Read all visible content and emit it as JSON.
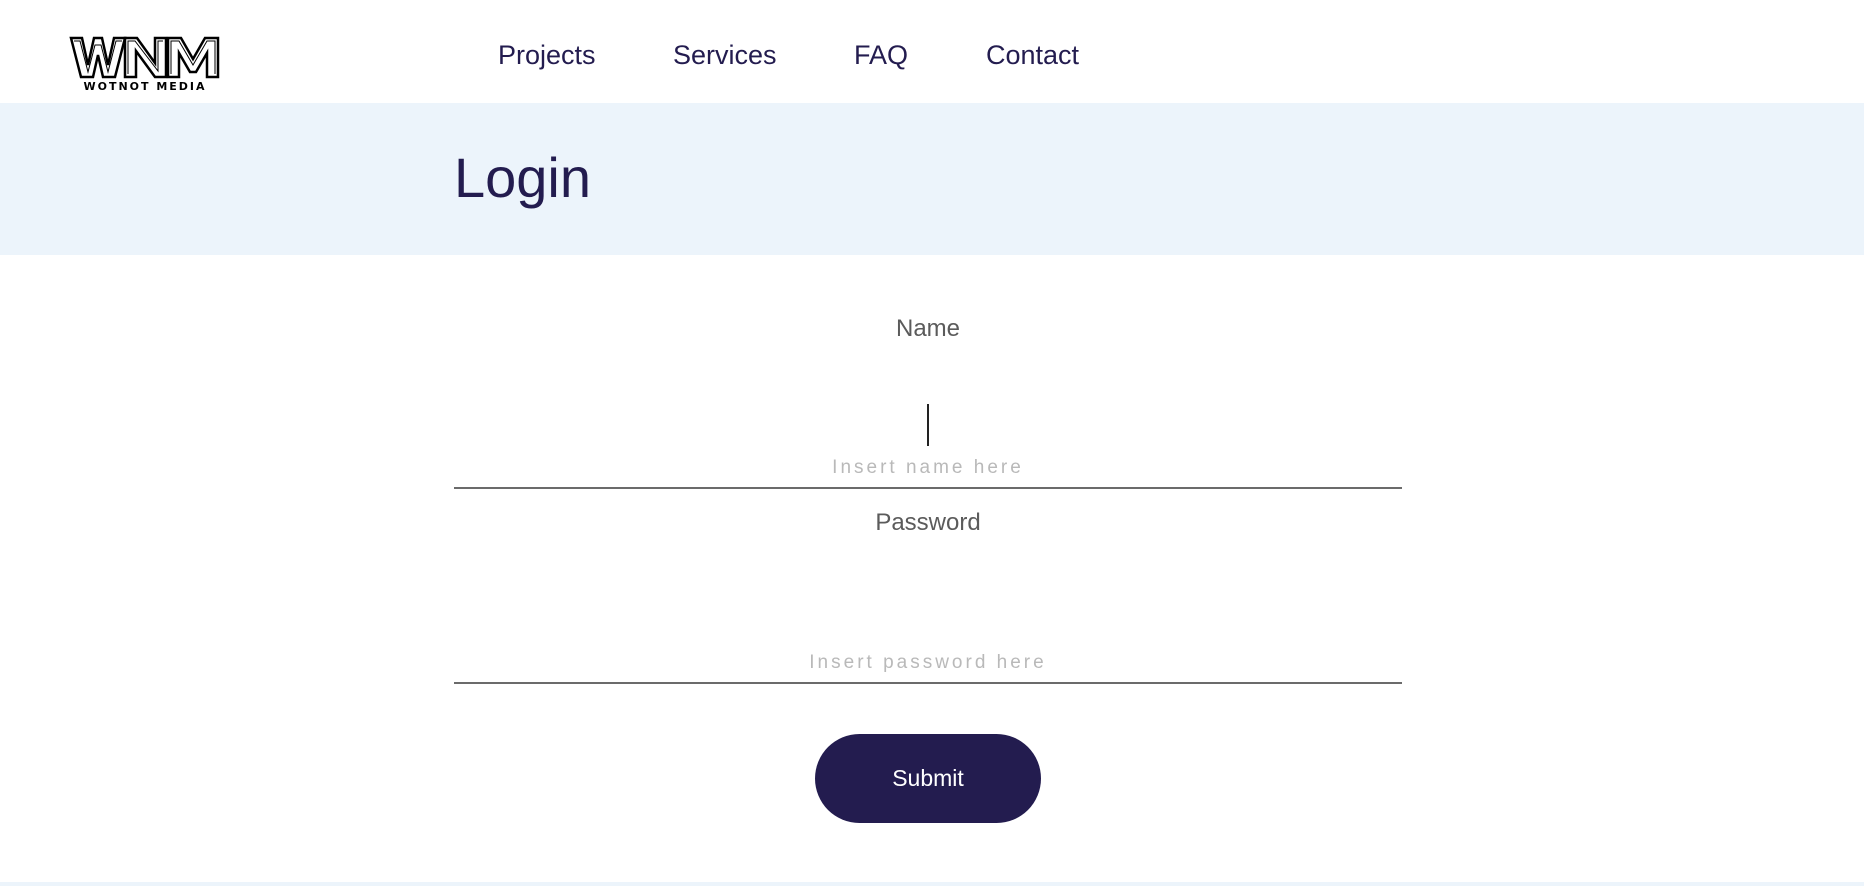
{
  "brand": {
    "logo_text": "WNM",
    "logo_subtext": "WOTNOT MEDIA"
  },
  "nav": {
    "items": [
      {
        "label": "Projects"
      },
      {
        "label": "Services"
      },
      {
        "label": "FAQ"
      },
      {
        "label": "Contact"
      }
    ]
  },
  "page": {
    "title": "Login"
  },
  "form": {
    "name_label": "Name",
    "name_placeholder": "Insert name here",
    "name_value": "",
    "password_label": "Password",
    "password_placeholder": "Insert password here",
    "password_value": "",
    "submit_label": "Submit"
  },
  "colors": {
    "brand_navy": "#231c4f",
    "hero_background": "#ecf4fb",
    "label_gray": "#5b5b5b",
    "placeholder_gray": "#b9b9b9",
    "underline_gray": "#6b6b6b"
  }
}
